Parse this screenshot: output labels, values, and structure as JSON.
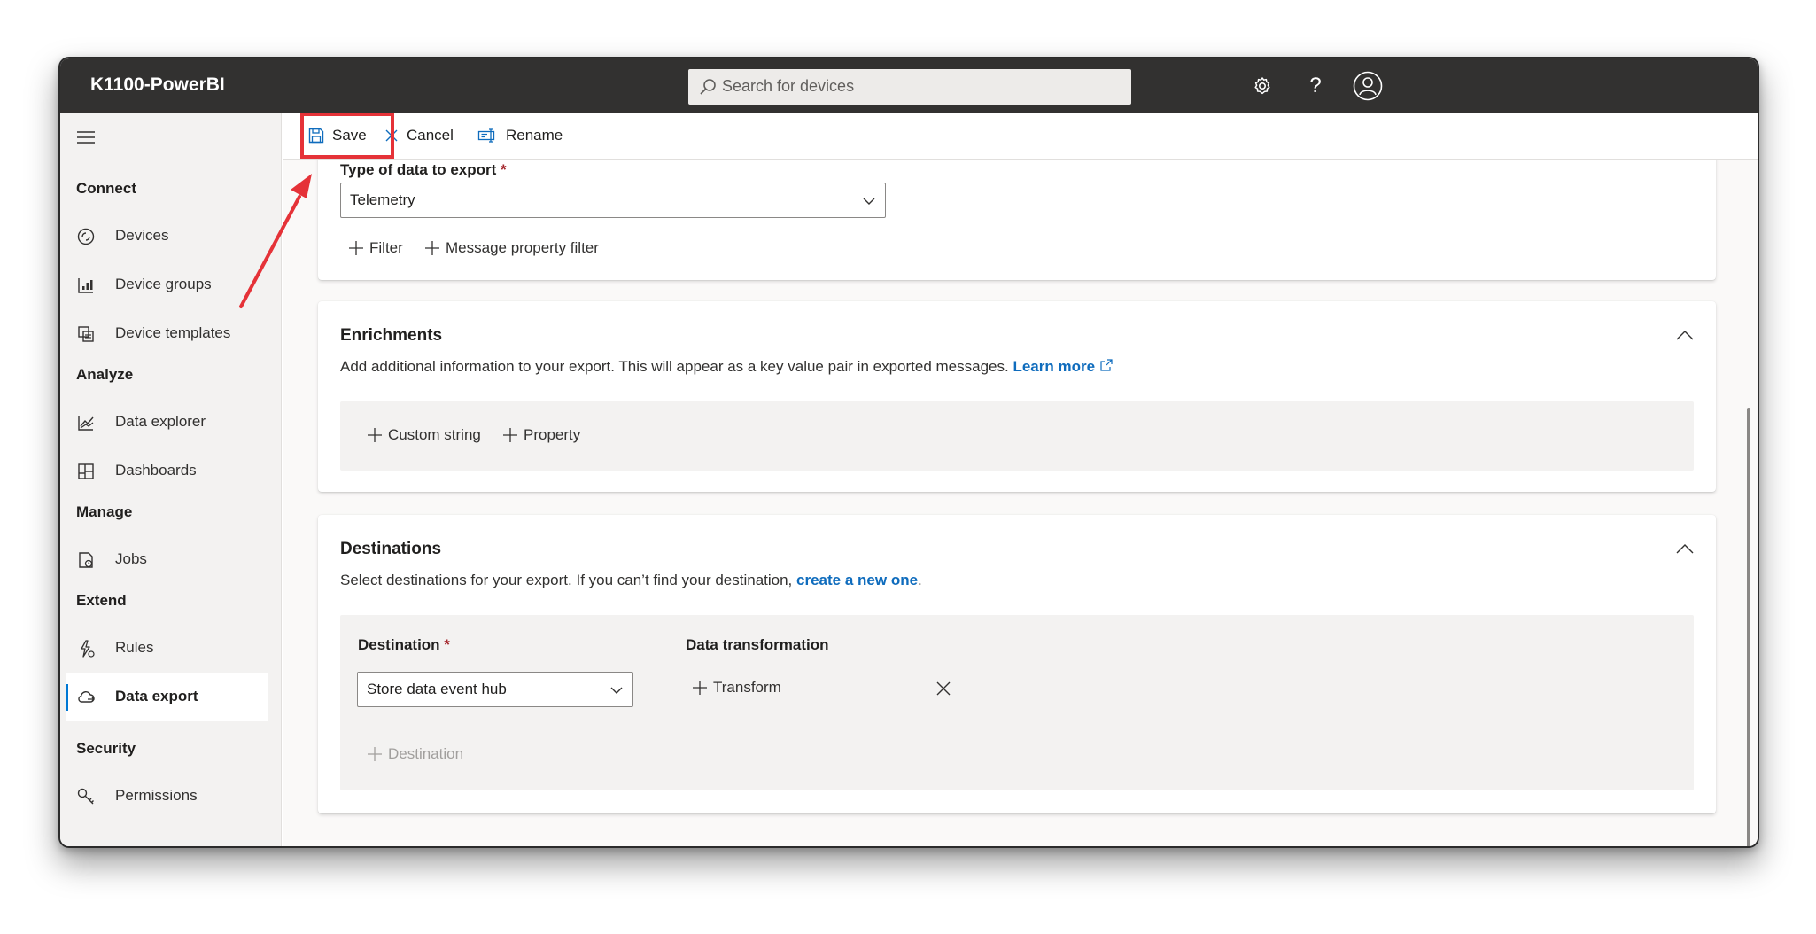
{
  "app": {
    "title": "K1100-PowerBI"
  },
  "search": {
    "placeholder": "Search for devices"
  },
  "topbar": {
    "icons": [
      "settings-icon",
      "help-icon",
      "account-icon"
    ],
    "help_glyph": "?"
  },
  "sidebar": {
    "sections": [
      {
        "label": "Connect",
        "items": [
          {
            "label": "Devices",
            "icon": "devices-icon"
          },
          {
            "label": "Device groups",
            "icon": "device-groups-icon"
          },
          {
            "label": "Device templates",
            "icon": "device-templates-icon"
          }
        ]
      },
      {
        "label": "Analyze",
        "items": [
          {
            "label": "Data explorer",
            "icon": "data-explorer-icon"
          },
          {
            "label": "Dashboards",
            "icon": "dashboards-icon"
          }
        ]
      },
      {
        "label": "Manage",
        "items": [
          {
            "label": "Jobs",
            "icon": "jobs-icon"
          }
        ]
      },
      {
        "label": "Extend",
        "items": [
          {
            "label": "Rules",
            "icon": "rules-icon"
          },
          {
            "label": "Data export",
            "icon": "data-export-icon",
            "active": true
          }
        ]
      },
      {
        "label": "Security",
        "items": [
          {
            "label": "Permissions",
            "icon": "permissions-icon"
          }
        ]
      }
    ]
  },
  "commandbar": {
    "save": "Save",
    "cancel": "Cancel",
    "rename": "Rename"
  },
  "export_type": {
    "label": "Type of data to export",
    "required_mark": "*",
    "value": "Telemetry",
    "filter_action": "Filter",
    "message_filter_action": "Message property filter"
  },
  "enrichments": {
    "title": "Enrichments",
    "description": "Add additional information to your export. This will appear as a key value pair in exported messages.",
    "link": "Learn more",
    "custom_string": "Custom string",
    "property": "Property"
  },
  "destinations": {
    "title": "Destinations",
    "description_prefix": "Select destinations for your export. If you can’t find your destination,",
    "link": "create a new one",
    "description_suffix": ".",
    "destination_label": "Destination",
    "required_mark": "*",
    "transformation_label": "Data transformation",
    "destination_value": "Store data event hub",
    "transform_action": "Transform",
    "add_destination": "Destination"
  },
  "colors": {
    "topbar": "#323130",
    "accent": "#0078d4",
    "link": "#0f6cbd",
    "highlight": "#e53238"
  }
}
